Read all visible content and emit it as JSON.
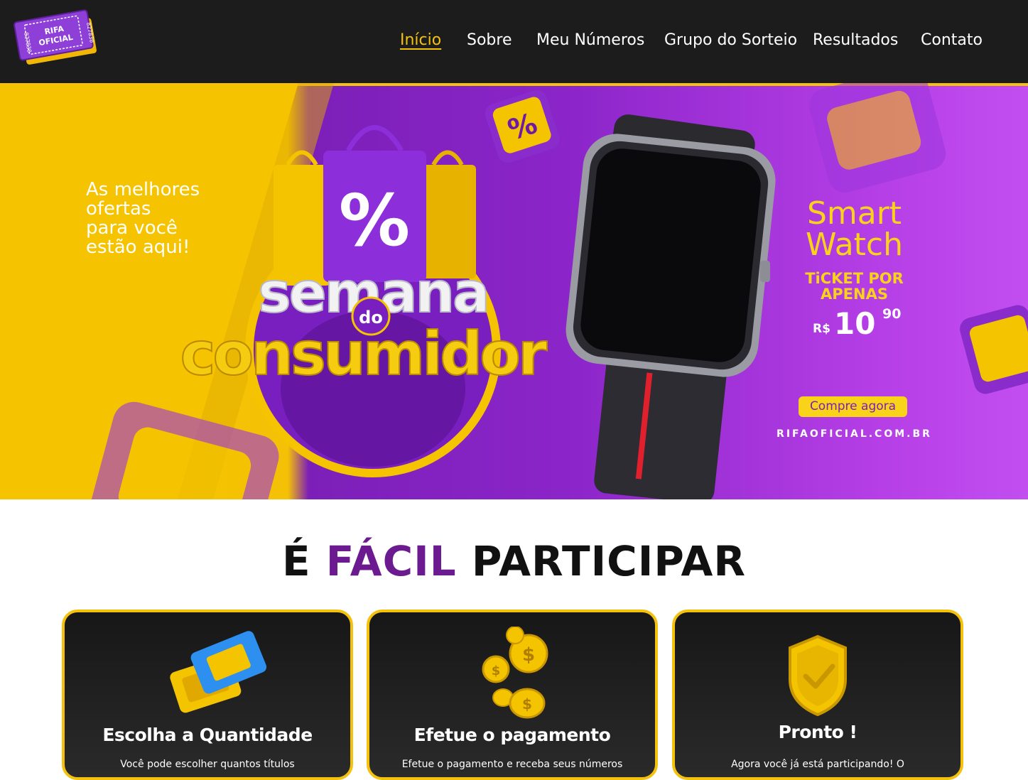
{
  "logo": {
    "line1": "RIFA",
    "line2": "OFICIAL",
    "serial": "827830"
  },
  "nav": {
    "items": [
      {
        "label": "Início",
        "active": true
      },
      {
        "label": "Sobre",
        "active": false
      },
      {
        "label": "Meu Números",
        "active": false
      },
      {
        "label": "Grupo do Sorteio",
        "active": false
      },
      {
        "label": "Resultados",
        "active": false
      },
      {
        "label": "Contato",
        "active": false
      }
    ]
  },
  "hero": {
    "tagline": "As melhores\nofertas\npara você\nestão aqui!",
    "campaign_line1": "semana",
    "campaign_small": "do",
    "campaign_line2": "consumidor",
    "product": "Smart\nWatch",
    "ticket": "TiCKET POR\nAPENAS",
    "price_currency": "R$",
    "price_int": "10",
    "price_cents": "90",
    "cta": "Compre agora",
    "site": "RIFAOFICIAL.COM.BR"
  },
  "section": {
    "title_part1": "É ",
    "title_highlight": "FÁCIL",
    "title_part2": " PARTICIPAR"
  },
  "cards": [
    {
      "icon": "tickets-icon",
      "title": "Escolha a Quantidade",
      "text": "Você pode escolher quantos títulos"
    },
    {
      "icon": "coins-icon",
      "title": "Efetue o pagamento",
      "text": "Efetue o pagamento e receba seus números"
    },
    {
      "icon": "shield-check-icon",
      "title": "Pronto !",
      "text": "Agora você já está participando! O"
    }
  ],
  "colors": {
    "nav_bg": "#1c1c1c",
    "accent": "#f4c20d",
    "purple": "#6b1a8f"
  }
}
